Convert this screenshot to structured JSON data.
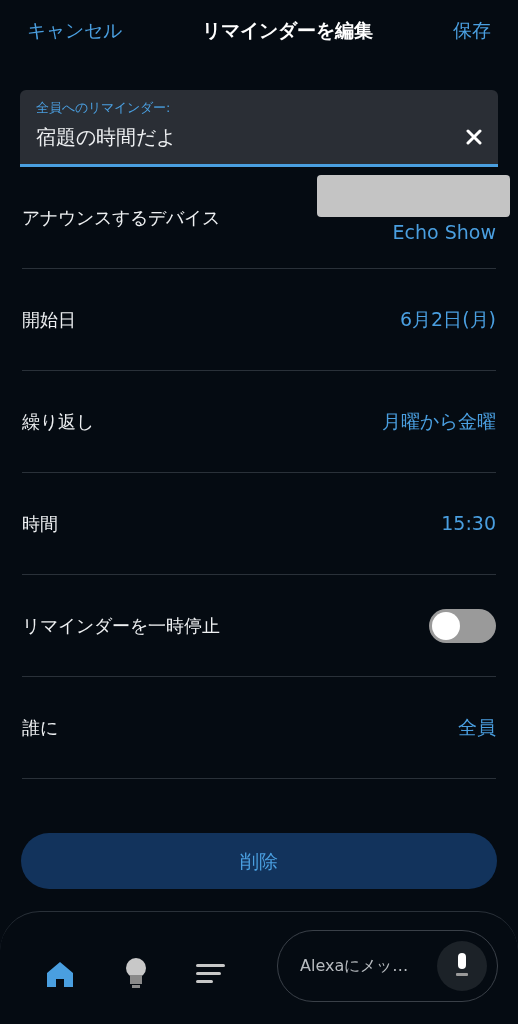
{
  "header": {
    "cancel": "キャンセル",
    "title": "リマインダーを編集",
    "save": "保存"
  },
  "reminder_field": {
    "label": "全員へのリマインダー:",
    "value": "宿題の時間だよ"
  },
  "rows": [
    {
      "kind": "device",
      "label": "アナウンスするデバイス",
      "value": "Echo Show"
    },
    {
      "kind": "value",
      "label": "開始日",
      "value": "6月2日(月)"
    },
    {
      "kind": "value",
      "label": "繰り返し",
      "value": "月曜から金曜"
    },
    {
      "kind": "value",
      "label": "時間",
      "value": "15:30"
    },
    {
      "kind": "toggle",
      "label": "リマインダーを一時停止",
      "on": false
    },
    {
      "kind": "value",
      "label": "誰に",
      "value": "全員"
    }
  ],
  "delete_button": "削除",
  "bottom_nav": {
    "items": [
      {
        "kind": "home",
        "selected": true
      },
      {
        "kind": "bulb",
        "selected": false
      },
      {
        "kind": "list",
        "selected": false
      }
    ],
    "message_placeholder": "Alexaにメッ…"
  }
}
